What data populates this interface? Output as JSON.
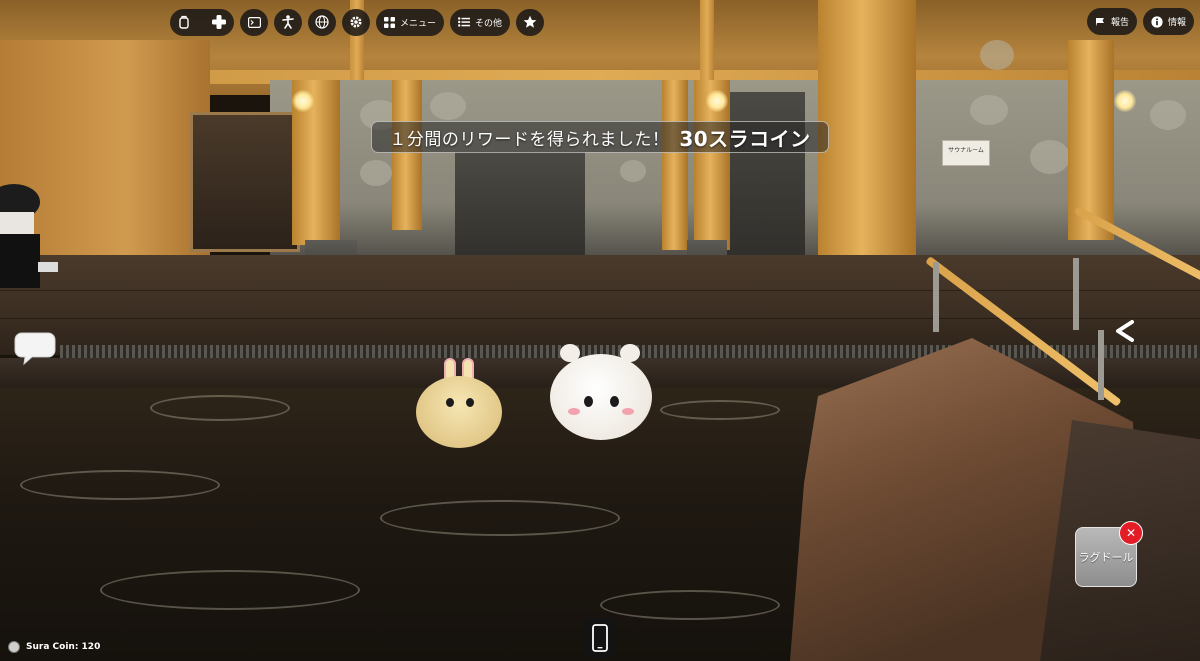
{
  "topbar": {
    "menu_label": "メニュー",
    "other_label": "その他"
  },
  "topright": {
    "report_label": "報告",
    "info_label": "情報"
  },
  "reward": {
    "message": "１分間のリワードを得られました！",
    "amount": "30スラコイン"
  },
  "scene": {
    "sign_text": "サウナルーム"
  },
  "ragdoll": {
    "label": "ラグドール",
    "close_glyph": "✕"
  },
  "currency": {
    "label": "Sura Coin: 120"
  },
  "colors": {
    "hud_bg": "#141416",
    "close_red": "#e31c25",
    "toast_border": "#ffffff"
  }
}
